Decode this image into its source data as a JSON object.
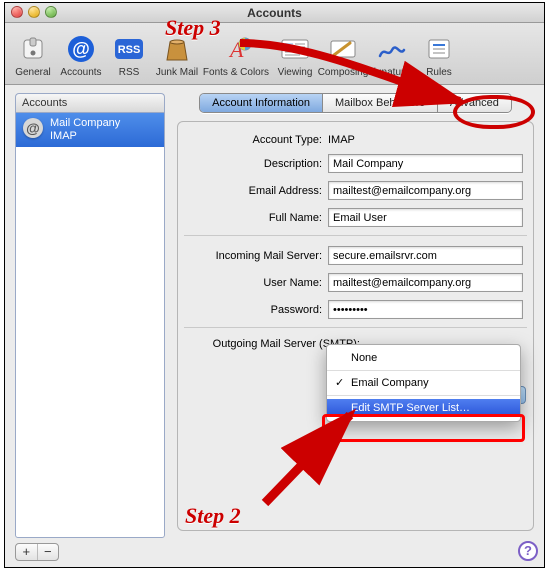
{
  "window": {
    "title": "Accounts"
  },
  "toolbar": {
    "items": [
      {
        "id": "general",
        "label": "General"
      },
      {
        "id": "accounts",
        "label": "Accounts"
      },
      {
        "id": "rss",
        "label": "RSS"
      },
      {
        "id": "junkmail",
        "label": "Junk Mail"
      },
      {
        "id": "fonts",
        "label": "Fonts & Colors"
      },
      {
        "id": "viewing",
        "label": "Viewing"
      },
      {
        "id": "composing",
        "label": "Composing"
      },
      {
        "id": "signatures",
        "label": "Signatures"
      },
      {
        "id": "rules",
        "label": "Rules"
      }
    ]
  },
  "sidebar": {
    "heading": "Accounts",
    "items": [
      {
        "name": "Mail Company",
        "sub": "IMAP"
      }
    ],
    "add_label": "+",
    "remove_label": "−"
  },
  "tabs": {
    "account_info": "Account Information",
    "mailbox": "Mailbox Behaviors",
    "advanced": "Advanced"
  },
  "form": {
    "account_type_label": "Account Type:",
    "account_type_value": "IMAP",
    "description_label": "Description:",
    "description_value": "Mail Company",
    "email_label": "Email Address:",
    "email_value": "mailtest@emailcompany.org",
    "fullname_label": "Full Name:",
    "fullname_value": "Email User",
    "incoming_label": "Incoming Mail Server:",
    "incoming_value": "secure.emailsrvr.com",
    "username_label": "User Name:",
    "username_value": "mailtest@emailcompany.org",
    "password_label": "Password:",
    "password_value": "•••••••••",
    "smtp_label": "Outgoing Mail Server (SMTP):"
  },
  "smtp_menu": {
    "none": "None",
    "selected": "Email Company",
    "edit": "Edit SMTP Server List…"
  },
  "help_label": "?",
  "annotations": {
    "step2": "Step 2",
    "step3": "Step 3"
  }
}
